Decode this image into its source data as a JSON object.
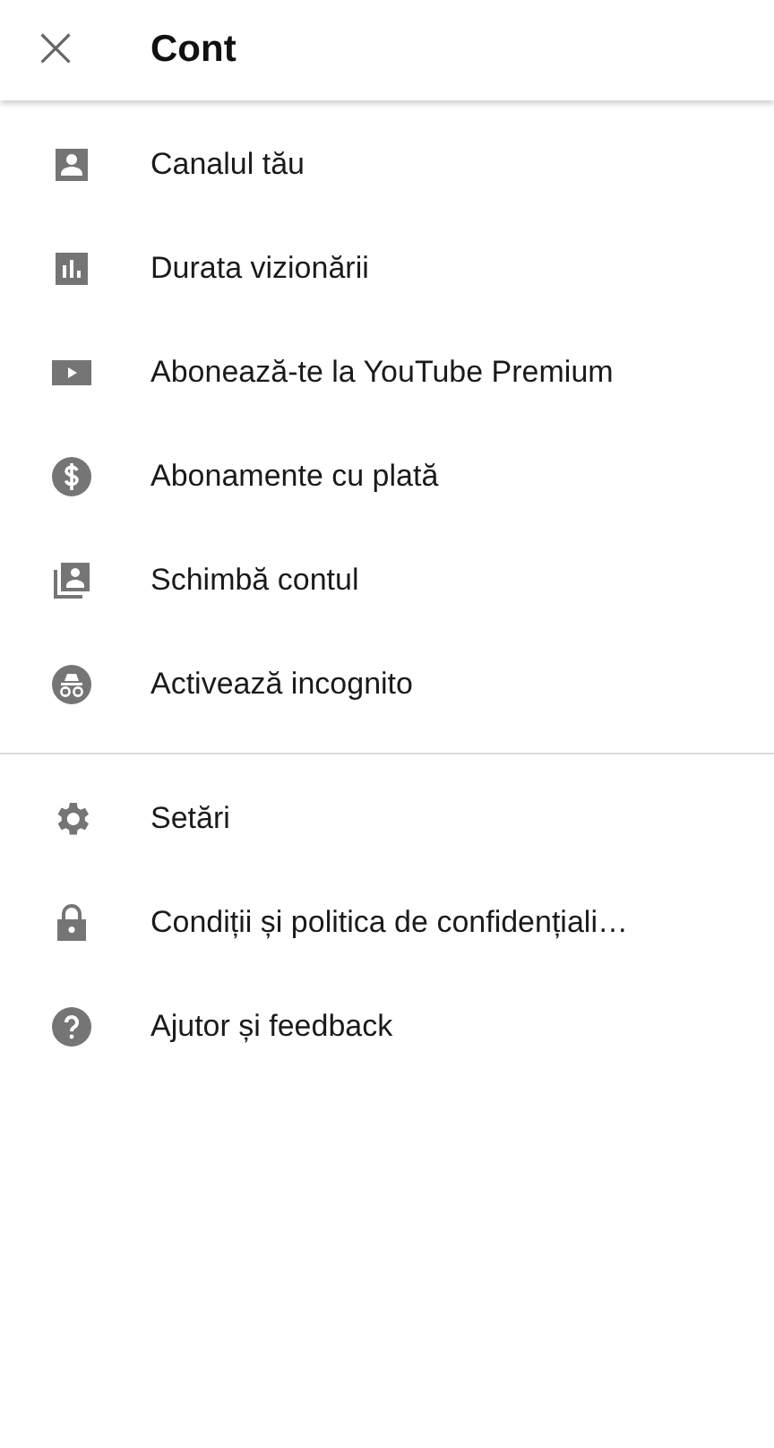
{
  "header": {
    "close": "×",
    "title": "Cont"
  },
  "sections": [
    {
      "items": [
        "Canalul tău",
        "Durata vizionării",
        "Abonează-te la YouTube Premium",
        "Abonamente cu plată",
        "Schimbă contul",
        "Activează incognito"
      ]
    },
    {
      "items": [
        "Setări",
        "Condiții și politica de confidențiali…",
        "Ajutor și feedback"
      ]
    }
  ]
}
